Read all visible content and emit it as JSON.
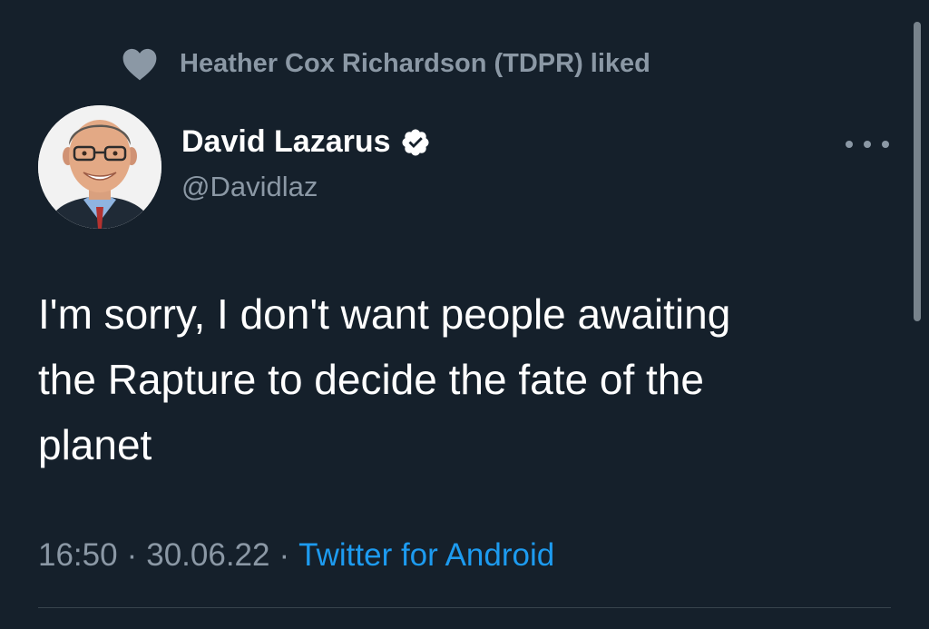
{
  "social_context": {
    "icon": "heart-icon",
    "text": "Heather Cox Richardson (TDPR) liked"
  },
  "author": {
    "display_name": "David Lazarus",
    "handle": "@Davidlaz",
    "verified": true,
    "verified_icon": "verified-badge-icon",
    "avatar_icon": "profile-photo"
  },
  "more_menu": {
    "icon": "more-dots-icon"
  },
  "tweet": {
    "text": "I'm sorry, I don't want people awaiting\nthe Rapture to decide the fate of the\nplanet"
  },
  "meta": {
    "time": "16:50",
    "separator": "·",
    "date": "30.06.22",
    "client": "Twitter for Android"
  },
  "colors": {
    "background": "#15202b",
    "muted_text": "#8b98a5",
    "link": "#1d9bf0",
    "divider": "#38444d"
  }
}
